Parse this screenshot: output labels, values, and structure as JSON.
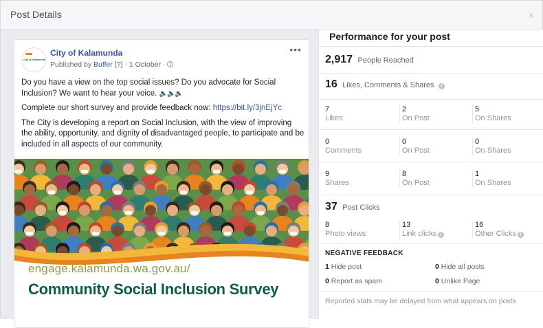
{
  "dialog": {
    "title": "Post Details",
    "close_symbol": "×"
  },
  "post": {
    "page_name": "City of Kalamunda",
    "avatar_text": "City of Kalamunda",
    "published_by_prefix": "Published by",
    "publisher": "Buffer",
    "publisher_help": "[?]",
    "date": "1 October",
    "privacy_icon": "globe-icon",
    "more_symbol": "•••",
    "paragraph_1": "Do you have a view on the top social issues? Do you advocate for Social Inclusion? We want to hear your voice.",
    "speaker_glyphs": "🔈🔈🔈",
    "paragraph_2_text": "Complete our short survey and provide feedback now:",
    "paragraph_2_url": "https://bit.ly/3jnEjYc",
    "paragraph_3": "The City is developing a report on Social Inclusion, with the view of improving the ability, opportunity, and dignity of disadvantaged people, to participate and be included in all aspects of our community.",
    "banner": {
      "url_text": "engage.kalamunda.wa.gov.au/",
      "headline": "Community Social Inclusion Survey",
      "colors": {
        "crowd_bg": "#4f8c44",
        "wave_orange": "#e8841e",
        "wave_yellow": "#f3b73a",
        "url_color": "#8c9d3b",
        "headline_color": "#0f5a4a"
      }
    }
  },
  "performance": {
    "title": "Performance for your post",
    "reach": {
      "value": "2,917",
      "label": "People Reached"
    },
    "engagement": {
      "value": "16",
      "label": "Likes, Comments & Shares"
    },
    "rows": [
      {
        "cells": [
          {
            "value": "7",
            "label": "Likes"
          },
          {
            "value": "2",
            "label": "On Post"
          },
          {
            "value": "5",
            "label": "On Shares"
          }
        ]
      },
      {
        "cells": [
          {
            "value": "0",
            "label": "Comments"
          },
          {
            "value": "0",
            "label": "On Post"
          },
          {
            "value": "0",
            "label": "On Shares"
          }
        ]
      },
      {
        "cells": [
          {
            "value": "9",
            "label": "Shares"
          },
          {
            "value": "8",
            "label": "On Post"
          },
          {
            "value": "1",
            "label": "On Shares"
          }
        ]
      }
    ],
    "clicks": {
      "value": "37",
      "label": "Post Clicks",
      "cells": [
        {
          "value": "8",
          "label": "Photo views"
        },
        {
          "value": "13",
          "label": "Link clicks"
        },
        {
          "value": "16",
          "label": "Other Clicks"
        }
      ]
    },
    "negative_feedback": {
      "title": "NEGATIVE FEEDBACK",
      "items": [
        {
          "value": "1",
          "label": "Hide post"
        },
        {
          "value": "0",
          "label": "Hide all posts"
        },
        {
          "value": "0",
          "label": "Report as spam"
        },
        {
          "value": "0",
          "label": "Unlike Page"
        }
      ]
    },
    "footer_note": "Reported stats may be delayed from what appears on posts"
  }
}
